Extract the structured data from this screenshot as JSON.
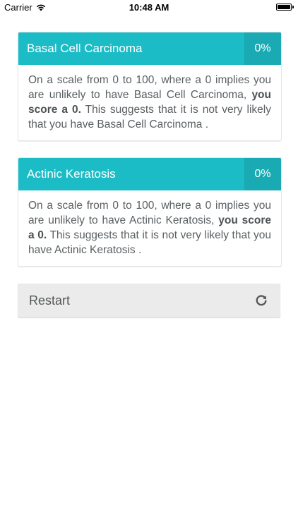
{
  "status_bar": {
    "carrier": "Carrier",
    "time": "10:48 AM"
  },
  "results": [
    {
      "title": "Basal Cell Carcinoma",
      "score": "0%",
      "text_before": "On a scale from 0 to 100, where a 0 implies you are unlikely to have Basal Cell Carcinoma, ",
      "text_bold": "you score a 0.",
      "text_after": " This suggests that it is not very likely that you have Basal Cell Carcinoma ."
    },
    {
      "title": "Actinic Keratosis",
      "score": "0%",
      "text_before": "On a scale from 0 to 100, where a 0 implies you are unlikely to have Actinic Keratosis, ",
      "text_bold": "you score a 0.",
      "text_after": " This suggests that it is not very likely that you have Actinic Keratosis ."
    }
  ],
  "restart": {
    "label": "Restart",
    "icon": "refresh-icon"
  },
  "colors": {
    "header": "#1cbcc6",
    "score_box": "#19aab3",
    "restart_bg": "#ebebeb"
  }
}
